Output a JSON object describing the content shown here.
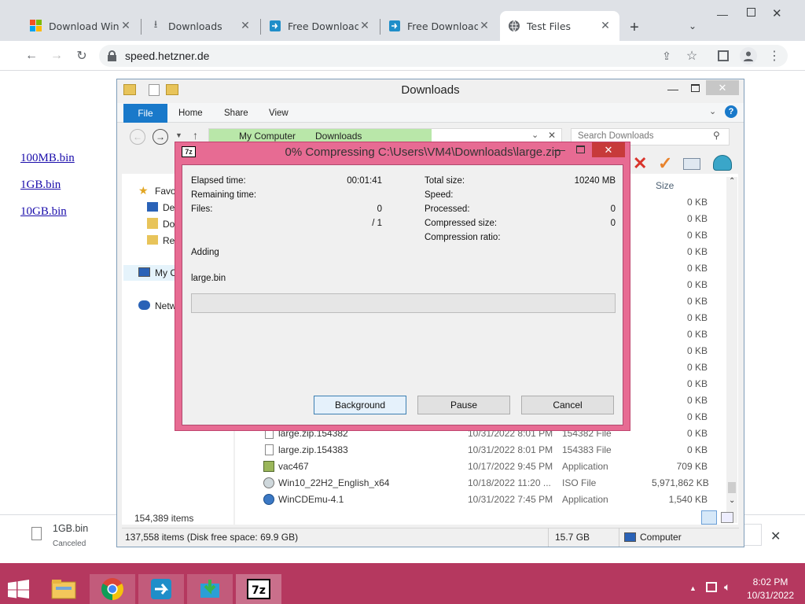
{
  "browser": {
    "tabs": [
      {
        "title": "Download Wind",
        "icon": "windows-logo-icon"
      },
      {
        "title": "Downloads",
        "icon": "download-icon"
      },
      {
        "title": "Free Download",
        "icon": "softpedia-icon"
      },
      {
        "title": "Free Download",
        "icon": "softpedia-icon"
      },
      {
        "title": "Test Files",
        "icon": "globe-icon",
        "active": true
      }
    ],
    "url": "speed.hetzner.de",
    "page_links": [
      "100MB.bin",
      "1GB.bin",
      "10GB.bin"
    ]
  },
  "explorer": {
    "title": "Downloads",
    "ribbon_tabs": [
      "File",
      "Home",
      "Share",
      "View"
    ],
    "breadcrumb": [
      "My Computer",
      "Downloads"
    ],
    "search_placeholder": "Search Downloads",
    "size_header": "Size",
    "nav_items": [
      "Favo",
      "De",
      "Do",
      "Re",
      "My C",
      "Netw"
    ],
    "sizes_above": [
      "0 KB",
      "0 KB",
      "0 KB",
      "0 KB",
      "0 KB",
      "0 KB",
      "0 KB",
      "0 KB",
      "0 KB",
      "0 KB",
      "0 KB",
      "0 KB",
      "0 KB",
      "0 KB"
    ],
    "files": [
      {
        "name": "large.zip.154382",
        "date": "10/31/2022 8:01 PM",
        "type": "154382 File",
        "size": "0 KB"
      },
      {
        "name": "large.zip.154383",
        "date": "10/31/2022 8:01 PM",
        "type": "154383 File",
        "size": "0 KB"
      },
      {
        "name": "vac467",
        "date": "10/17/2022 9:45 PM",
        "type": "Application",
        "size": "709 KB"
      },
      {
        "name": "Win10_22H2_English_x64",
        "date": "10/18/2022 11:20 ...",
        "type": "ISO File",
        "size": "5,971,862 KB"
      },
      {
        "name": "WinCDEmu-4.1",
        "date": "10/31/2022 7:45 PM",
        "type": "Application",
        "size": "1,540 KB"
      }
    ],
    "item_count": "154,389 items",
    "status_items": "137,558 items (Disk free space: 69.9 GB)",
    "status_size": "15.7 GB",
    "status_location": "Computer"
  },
  "dialog": {
    "title": "0% Compressing C:\\Users\\VM4\\Downloads\\large.zip",
    "elapsed_label": "Elapsed time:",
    "elapsed": "00:01:41",
    "remaining_label": "Remaining time:",
    "remaining": "",
    "files_label": "Files:",
    "files": "0",
    "files_total": "/ 1",
    "total_size_label": "Total size:",
    "total_size": "10240 MB",
    "speed_label": "Speed:",
    "speed": "",
    "processed_label": "Processed:",
    "processed": "0",
    "compressed_label": "Compressed size:",
    "compressed": "0",
    "ratio_label": "Compression ratio:",
    "ratio": "",
    "action": "Adding",
    "current_file": "large.bin",
    "progress": 0,
    "buttons": {
      "background": "Background",
      "pause": "Pause",
      "cancel": "Cancel"
    }
  },
  "download_bar": {
    "file": "1GB.bin",
    "status": "Canceled"
  },
  "taskbar": {
    "time": "8:02 PM",
    "date": "10/31/2022"
  },
  "colors": {
    "dialog_frame": "#e76b93",
    "taskbar": "#b5385f",
    "ribbon_file": "#1979ca",
    "link": "#1a0dab"
  }
}
